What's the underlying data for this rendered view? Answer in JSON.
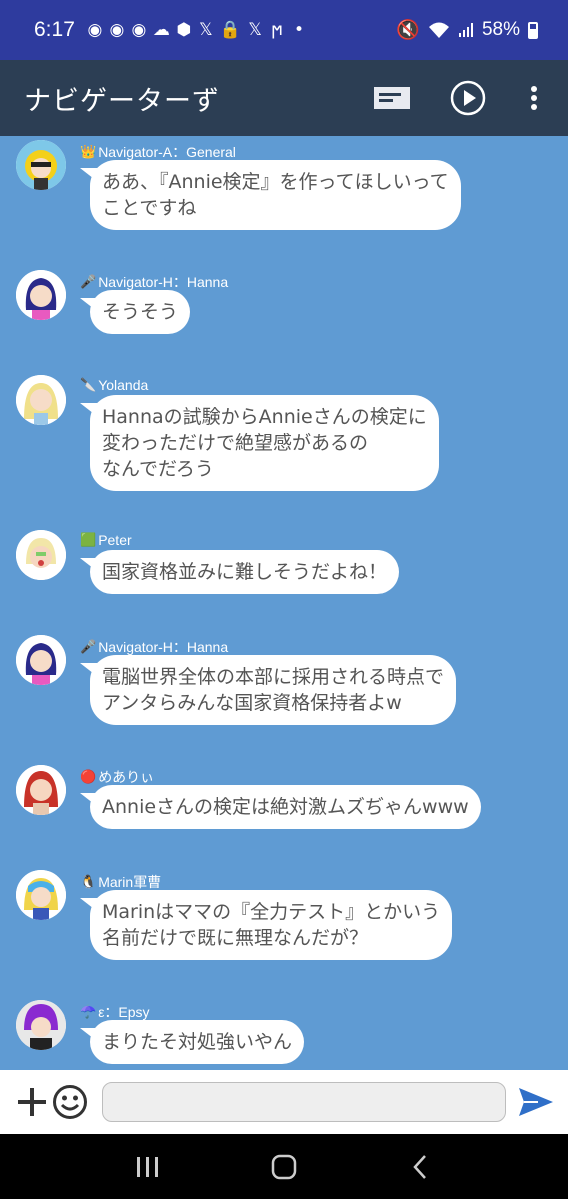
{
  "status": {
    "time": "6:17",
    "battery": "58%",
    "notification_icons": [
      "discord-icon",
      "discord-icon",
      "discord-icon",
      "cloud-icon",
      "box-icon",
      "x-icon",
      "lock-icon",
      "x-icon",
      "misskey-icon",
      "dot-icon"
    ]
  },
  "app": {
    "title": "ナビゲーターず",
    "accent": "#2c3e54",
    "chat_bg": "#5f9bd3"
  },
  "messages": [
    {
      "badge": "👑",
      "sender": "Navigator-A：General",
      "text": "ああ、『Annie検定』を作ってほしいって\nことですね",
      "avatar": "navigator-a-avatar"
    },
    {
      "badge": "🎤",
      "sender": "Navigator-H：Hanna",
      "text": "そうそう",
      "avatar": "navigator-h-avatar"
    },
    {
      "badge": "🔪",
      "sender": "Yolanda",
      "text": "Hannaの試験からAnnieさんの検定に\n変わっただけで絶望感があるの\nなんでだろう",
      "avatar": "yolanda-avatar"
    },
    {
      "badge": "🟩",
      "sender": "Peter",
      "text": "国家資格並みに難しそうだよね！",
      "avatar": "peter-avatar"
    },
    {
      "badge": "🎤",
      "sender": "Navigator-H：Hanna",
      "text": "電脳世界全体の本部に採用される時点で\nアンタらみんな国家資格保持者よw",
      "avatar": "navigator-h-avatar"
    },
    {
      "badge": "🔴",
      "sender": "めありぃ",
      "text": "Annieさんの検定は絶対激ムズぢゃんwww",
      "avatar": "meari-avatar"
    },
    {
      "badge": "🐧",
      "sender": "Marin軍曹",
      "text": "Marinはママの『全力テスト』とかいう\n名前だけで既に無理なんだが？",
      "avatar": "marin-avatar"
    },
    {
      "badge": "☂️",
      "sender": "ε：Epsy",
      "text": "まりたそ対処強いやん",
      "avatar": "epsy-avatar"
    }
  ]
}
